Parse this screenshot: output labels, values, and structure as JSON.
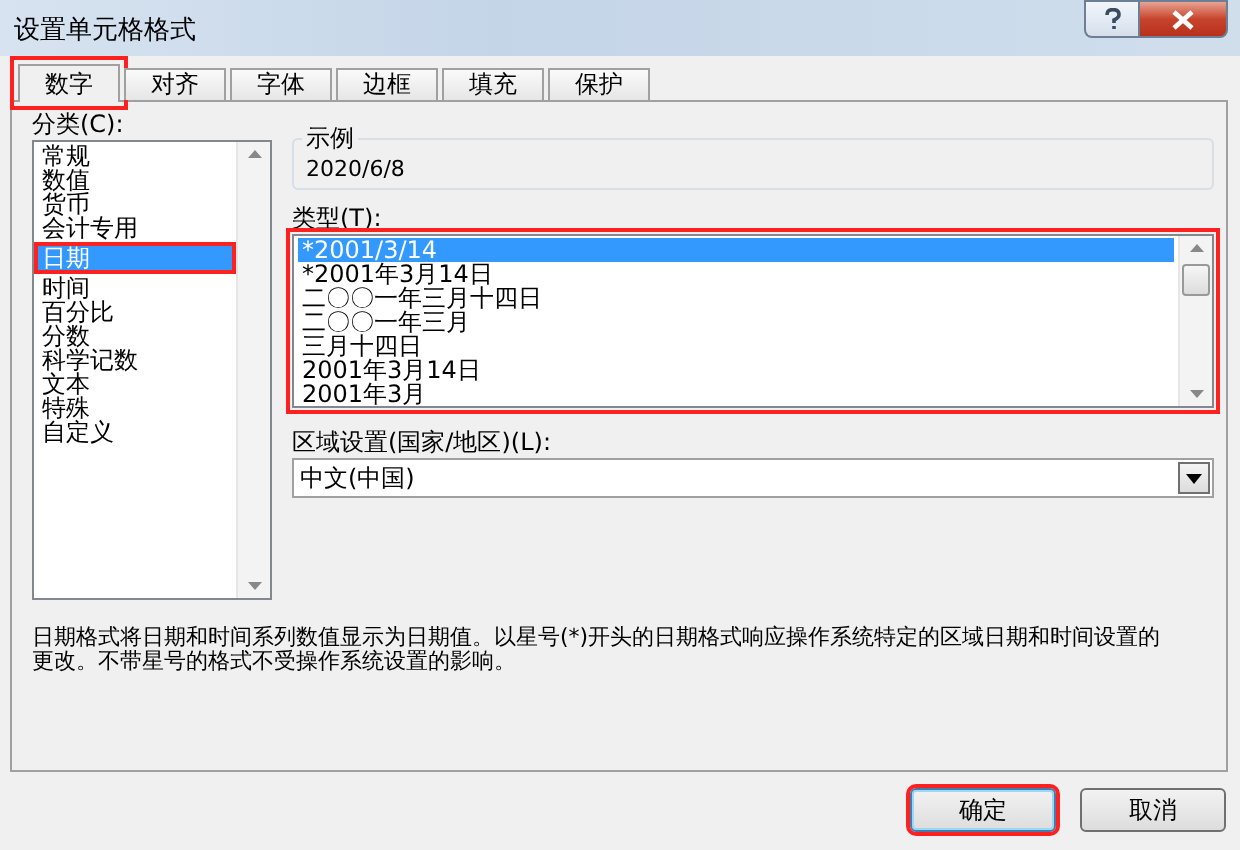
{
  "window": {
    "title": "设置单元格格式"
  },
  "tabs": [
    {
      "label": "数字",
      "selected": true,
      "highlighted": true
    },
    {
      "label": "对齐",
      "selected": false,
      "highlighted": false
    },
    {
      "label": "字体",
      "selected": false,
      "highlighted": false
    },
    {
      "label": "边框",
      "selected": false,
      "highlighted": false
    },
    {
      "label": "填充",
      "selected": false,
      "highlighted": false
    },
    {
      "label": "保护",
      "selected": false,
      "highlighted": false
    }
  ],
  "category": {
    "label": "分类(C):",
    "items": [
      {
        "label": "常规",
        "selected": false,
        "highlighted": false
      },
      {
        "label": "数值",
        "selected": false,
        "highlighted": false
      },
      {
        "label": "货币",
        "selected": false,
        "highlighted": false
      },
      {
        "label": "会计专用",
        "selected": false,
        "highlighted": false
      },
      {
        "label": "日期",
        "selected": true,
        "highlighted": true
      },
      {
        "label": "时间",
        "selected": false,
        "highlighted": false
      },
      {
        "label": "百分比",
        "selected": false,
        "highlighted": false
      },
      {
        "label": "分数",
        "selected": false,
        "highlighted": false
      },
      {
        "label": "科学记数",
        "selected": false,
        "highlighted": false
      },
      {
        "label": "文本",
        "selected": false,
        "highlighted": false
      },
      {
        "label": "特殊",
        "selected": false,
        "highlighted": false
      },
      {
        "label": "自定义",
        "selected": false,
        "highlighted": false
      }
    ]
  },
  "sample": {
    "label": "示例",
    "value": "2020/6/8"
  },
  "type": {
    "label": "类型(T):",
    "highlighted": true,
    "items": [
      {
        "label": "*2001/3/14",
        "selected": true
      },
      {
        "label": "*2001年3月14日",
        "selected": false
      },
      {
        "label": "二〇〇一年三月十四日",
        "selected": false
      },
      {
        "label": "二〇〇一年三月",
        "selected": false
      },
      {
        "label": "三月十四日",
        "selected": false
      },
      {
        "label": "2001年3月14日",
        "selected": false
      },
      {
        "label": "2001年3月",
        "selected": false
      }
    ]
  },
  "locale": {
    "label": "区域设置(国家/地区)(L):",
    "value": "中文(中国)"
  },
  "description": "日期格式将日期和时间系列数值显示为日期值。以星号(*)开头的日期格式响应操作系统特定的区域日期和时间设置的更改。不带星号的格式不受操作系统设置的影响。",
  "buttons": [
    {
      "label": "确定",
      "default": true,
      "highlighted": true
    },
    {
      "label": "取消",
      "default": false,
      "highlighted": false
    }
  ]
}
